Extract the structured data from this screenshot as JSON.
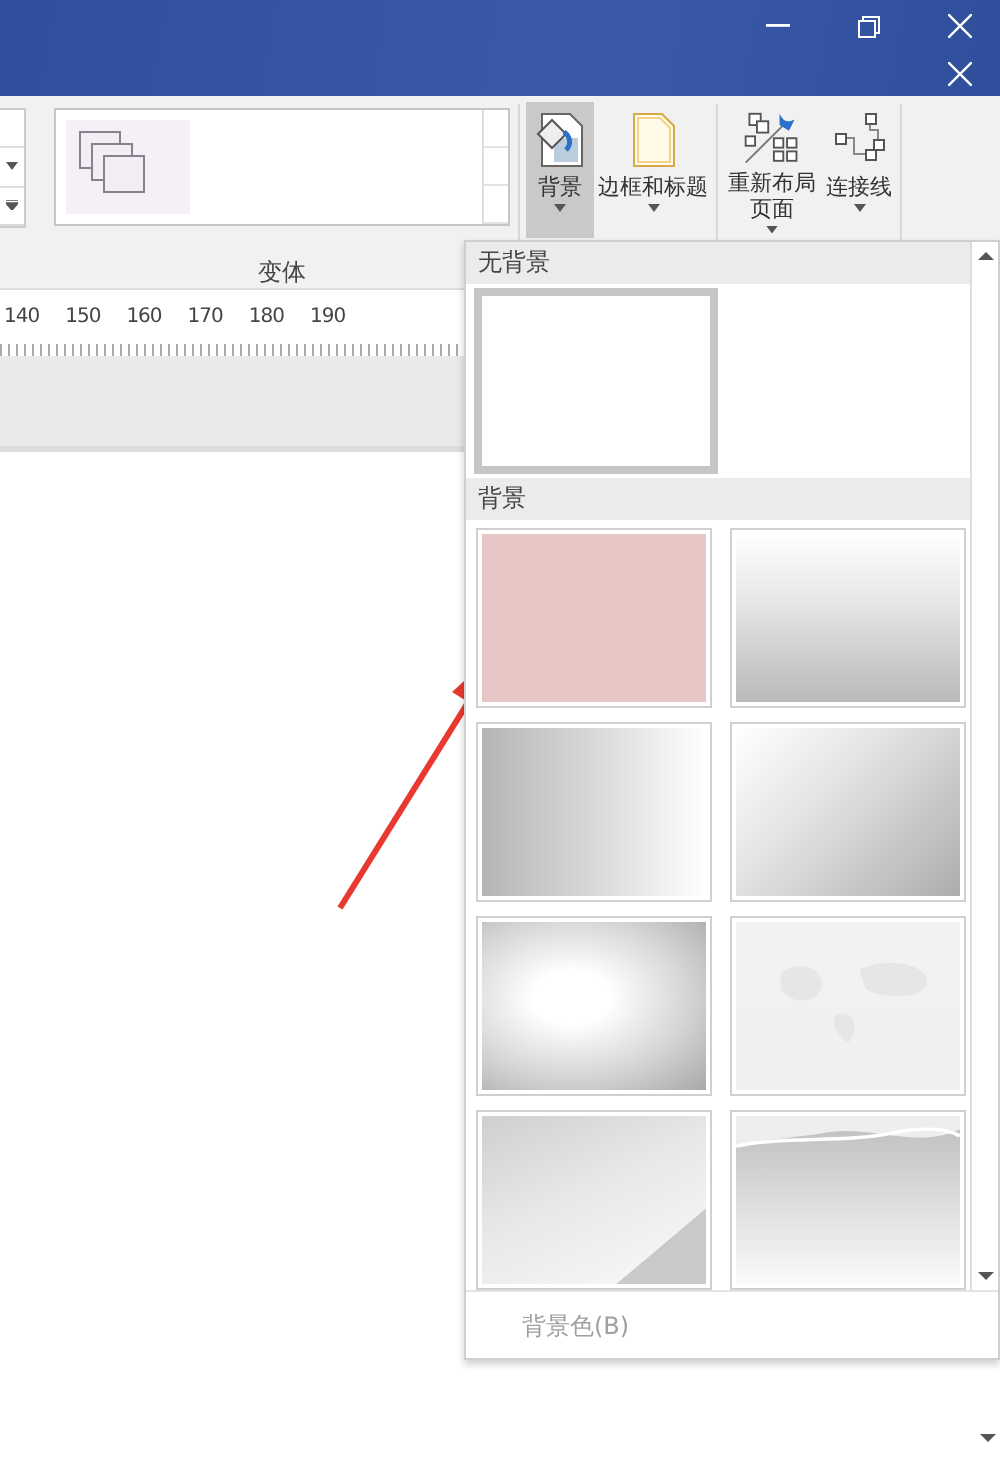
{
  "ribbon": {
    "variants": {
      "label": "变体"
    },
    "buttons": [
      {
        "label": "背景",
        "selected": true,
        "kind": "background"
      },
      {
        "label": "边框和标题",
        "selected": false,
        "kind": "border"
      },
      {
        "label": "重新布局页面",
        "selected": false,
        "kind": "relayout"
      },
      {
        "label": "连接线",
        "selected": false,
        "kind": "connector"
      }
    ]
  },
  "ruler": {
    "labels": [
      "140",
      "150",
      "160",
      "170",
      "180",
      "190"
    ]
  },
  "background_menu": {
    "none_section": {
      "title": "无背景",
      "items": [
        {
          "selected": true
        }
      ]
    },
    "section": {
      "title": "背景",
      "items": [
        {
          "kind": "solid",
          "color": "#e9c6c6",
          "selected": false
        },
        {
          "kind": "vertical",
          "selected": false
        },
        {
          "kind": "horizontal",
          "selected": false
        },
        {
          "kind": "diagonal",
          "selected": false
        },
        {
          "kind": "radial",
          "selected": false
        },
        {
          "kind": "map",
          "selected": false
        },
        {
          "kind": "triangle",
          "selected": false
        },
        {
          "kind": "wave",
          "selected": false
        }
      ]
    },
    "footer": {
      "label": "背景色(B)",
      "disabled": true
    }
  }
}
